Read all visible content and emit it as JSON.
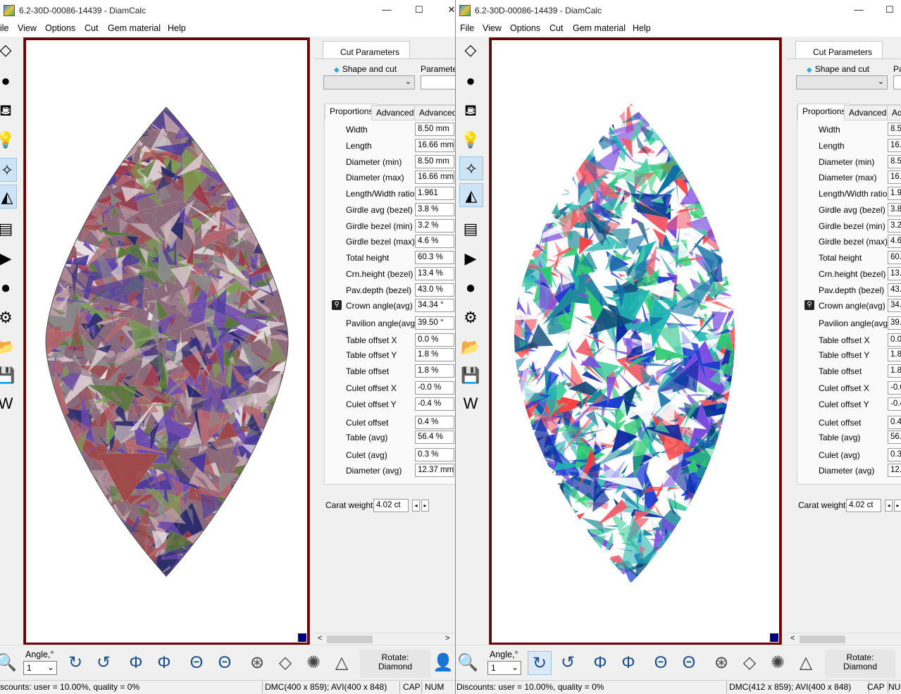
{
  "left": {
    "title": "6.2-30D-00086-14439 - DiamCalc",
    "menu": [
      "ile",
      "View",
      "Options",
      "Cut",
      "Gem material",
      "Help"
    ],
    "status": {
      "discounts": "scounts: user = 10.00%, quality = 0%",
      "dmc": "DMC(400 x 859); AVI(400 x 848)",
      "cap": "CAP",
      "num": "NUM"
    }
  },
  "right": {
    "title": "6.2-30D-00086-14439 - DiamCalc",
    "menu": [
      "File",
      "View",
      "Options",
      "Cut",
      "Gem material",
      "Help"
    ],
    "status": {
      "discounts": "Discounts: user = 10.00%, quality = 0%",
      "dmc": "DMC(412 x 859); AVI(400 x 848)",
      "cap": "CAP",
      "num": "NUM"
    }
  },
  "window_buttons": {
    "minimize": "—",
    "maximize": "☐",
    "close": "✕"
  },
  "panel": {
    "cut_params_tab": "Cut Parameters",
    "shape_and_cut": "Shape and cut",
    "parameters": "Parameters",
    "parameters_short": "Pa",
    "tabs": [
      "Proportions",
      "Advanced",
      "Advanced"
    ],
    "tab3_short": "Adv",
    "carat_label": "Carat weight",
    "carat_value": "4.02 ct",
    "scroll_left": "<",
    "scroll_right": ">",
    "step_left": "◂",
    "step_right": "▸"
  },
  "proportions": [
    {
      "label": "Width",
      "value": "8.50 mm",
      "short": "8.50"
    },
    {
      "label": "Length",
      "value": "16.66 mm",
      "short": "16.6"
    },
    {
      "label": "Diameter (min)",
      "value": "8.50 mm",
      "short": "8.50"
    },
    {
      "label": "Diameter (max)",
      "value": "16.66 mm",
      "short": "16.6"
    },
    {
      "label": "Length/Width ratio",
      "value": "1.961",
      "short": "1.96"
    },
    {
      "label": "Girdle avg (bezel)",
      "value": "3.8 %",
      "short": "3.8"
    },
    {
      "label": "Girdle bezel (min)",
      "value": "3.2 %",
      "short": "3.2"
    },
    {
      "label": "Girdle bezel (max)",
      "value": "4.6 %",
      "short": "4.6"
    },
    {
      "label": "Total height",
      "value": "60.3 %",
      "short": "60.3"
    },
    {
      "label": "Crn.height (bezel)",
      "value": "13.4 %",
      "short": "13.4"
    },
    {
      "label": "Pav.depth (bezel)",
      "value": "43.0 %",
      "short": "43.0"
    },
    {
      "label": "Crown angle(avg)",
      "value": "34.34 °",
      "short": "34.3"
    },
    {
      "label": "Pavilion angle(avg)",
      "value": "39.50 °",
      "short": "39.5"
    },
    {
      "label": "Table offset X",
      "value": "0.0 %",
      "short": "0.0"
    },
    {
      "label": "Table offset Y",
      "value": "1.8 %",
      "short": "1.8"
    },
    {
      "label": "Table offset",
      "value": "1.8 %",
      "short": "1.8"
    },
    {
      "label": "Culet offset X",
      "value": "-0.0 %",
      "short": "-0.0"
    },
    {
      "label": "Culet offset Y",
      "value": "-0.4 %",
      "short": "-0.4"
    },
    {
      "label": "Culet offset",
      "value": "0.4 %",
      "short": "0.4"
    },
    {
      "label": "Table (avg)",
      "value": "56.4 %",
      "short": "56.4"
    },
    {
      "label": "Culet (avg)",
      "value": "0.3 %",
      "short": "0.3"
    },
    {
      "label": "Diameter (avg)",
      "value": "12.37 mm",
      "short": "12.3"
    }
  ],
  "bottom": {
    "angle_label": "Angle,°",
    "angle_value": "1",
    "rotate_label": "Rotate:",
    "rotate_value": "Diamond"
  },
  "icons": {
    "toolbar": [
      "diamond-outline-icon",
      "gem-sphere-icon",
      "paint-bucket-icon",
      "lightbulb-icon",
      "sparkle-diamond-icon",
      "rainbow-prism-icon",
      "report-icon",
      "video-play-icon",
      "video-record-icon",
      "diamond-wheel-icon",
      "open-folder-icon",
      "save-disk-icon",
      "word-doc-icon"
    ],
    "bottom": [
      "zoom-icon",
      "rotate-cw-icon",
      "rotate-ccw-icon",
      "flip-v-icon",
      "flip-v2-icon",
      "flip-h-icon",
      "flip-h2-icon",
      "top-view-icon",
      "side-view-icon",
      "bottom-view-icon",
      "profile-view-icon"
    ]
  },
  "colors": {
    "viewport_border": "#6b0000",
    "accent_blue": "#000080"
  }
}
